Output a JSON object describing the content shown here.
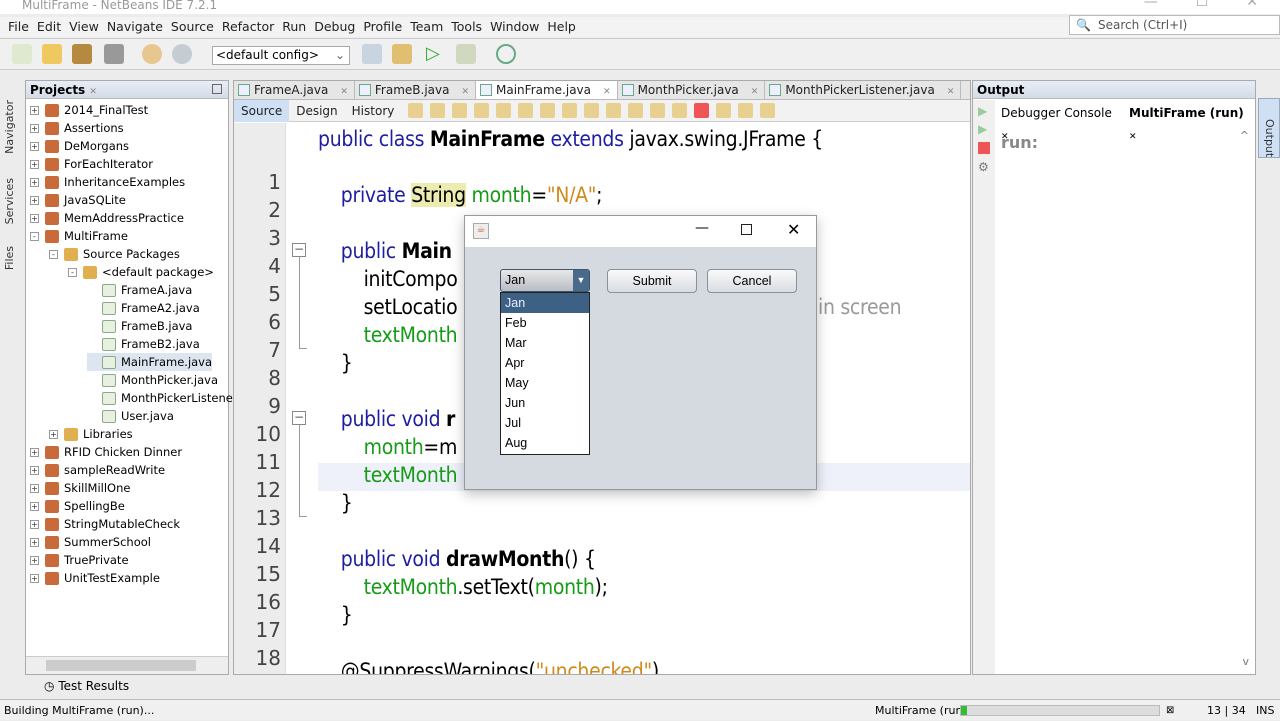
{
  "window": {
    "title": "MultiFrame - NetBeans IDE 7.2.1"
  },
  "menu": [
    "File",
    "Edit",
    "View",
    "Navigate",
    "Source",
    "Refactor",
    "Run",
    "Debug",
    "Profile",
    "Team",
    "Tools",
    "Window",
    "Help"
  ],
  "search": {
    "placeholder": "Search (Ctrl+I)"
  },
  "toolbar": {
    "config": "<default config>"
  },
  "side_tabs": [
    "Navigator",
    "Services",
    "Files"
  ],
  "projects": {
    "title": "Projects",
    "items": [
      {
        "label": "2014_FinalTest",
        "level": 0,
        "exp": "+"
      },
      {
        "label": "Assertions",
        "level": 0,
        "exp": "+"
      },
      {
        "label": "DeMorgans",
        "level": 0,
        "exp": "+"
      },
      {
        "label": "ForEachIterator",
        "level": 0,
        "exp": "+"
      },
      {
        "label": "InheritanceExamples",
        "level": 0,
        "exp": "+"
      },
      {
        "label": "JavaSQLite",
        "level": 0,
        "exp": "+"
      },
      {
        "label": "MemAddressPractice",
        "level": 0,
        "exp": "+"
      },
      {
        "label": "MultiFrame",
        "level": 0,
        "exp": "-"
      },
      {
        "label": "Source Packages",
        "level": 1,
        "exp": "-"
      },
      {
        "label": "<default package>",
        "level": 2,
        "exp": "-"
      },
      {
        "label": "FrameA.java",
        "level": 3
      },
      {
        "label": "FrameA2.java",
        "level": 3
      },
      {
        "label": "FrameB.java",
        "level": 3
      },
      {
        "label": "FrameB2.java",
        "level": 3
      },
      {
        "label": "MainFrame.java",
        "level": 3,
        "selected": true
      },
      {
        "label": "MonthPicker.java",
        "level": 3
      },
      {
        "label": "MonthPickerListener.java",
        "level": 3
      },
      {
        "label": "User.java",
        "level": 3
      },
      {
        "label": "Libraries",
        "level": 1,
        "exp": "+"
      },
      {
        "label": "RFID Chicken Dinner",
        "level": 0,
        "exp": "+"
      },
      {
        "label": "sampleReadWrite",
        "level": 0,
        "exp": "+"
      },
      {
        "label": "SkillMillOne",
        "level": 0,
        "exp": "+"
      },
      {
        "label": "SpellingBe",
        "level": 0,
        "exp": "+"
      },
      {
        "label": "StringMutableCheck",
        "level": 0,
        "exp": "+"
      },
      {
        "label": "SummerSchool",
        "level": 0,
        "exp": "+"
      },
      {
        "label": "TruePrivate",
        "level": 0,
        "exp": "+"
      },
      {
        "label": "UnitTestExample",
        "level": 0,
        "exp": "+"
      }
    ]
  },
  "editor": {
    "tabs": [
      "FrameA.java",
      "FrameB.java",
      "MainFrame.java",
      "MonthPicker.java",
      "MonthPickerListener.java"
    ],
    "active_tab": 2,
    "view_tabs": [
      "Source",
      "Design",
      "History"
    ],
    "lines": [
      [
        [
          "kw",
          "public class "
        ],
        [
          "b",
          "MainFrame"
        ],
        [
          "kw",
          " extends "
        ],
        [
          "",
          "javax.swing.JFrame {"
        ]
      ],
      [],
      [
        [
          "kw",
          "    private "
        ],
        [
          "hl",
          "String"
        ],
        [
          "fld",
          " month"
        ],
        [
          "",
          "="
        ],
        [
          "str",
          "\"N/A\""
        ],
        [
          "",
          ";"
        ]
      ],
      [],
      [
        [
          "kw",
          "    public "
        ],
        [
          "b",
          "Main"
        ]
      ],
      [
        [
          "",
          "        initCompo"
        ]
      ],
      [
        [
          "",
          "        setLocatio"
        ]
      ],
      [
        [
          "fld",
          "        textMonth"
        ]
      ],
      [
        [
          "",
          "    }"
        ]
      ],
      [],
      [
        [
          "kw",
          "    public void "
        ],
        [
          "b",
          "r"
        ]
      ],
      [
        [
          "fld",
          "        month"
        ],
        [
          "",
          "=m"
        ]
      ],
      [
        [
          "fld",
          "        textMonth"
        ]
      ],
      [
        [
          "",
          "    }"
        ]
      ],
      [],
      [
        [
          "kw",
          "    public void "
        ],
        [
          "b",
          "drawMonth"
        ],
        [
          "",
          "() {"
        ]
      ],
      [
        [
          "fld",
          "        textMonth"
        ],
        [
          "",
          ".setText("
        ],
        [
          "fld",
          "month"
        ],
        [
          "",
          ");"
        ]
      ],
      [
        [
          "",
          "    }"
        ]
      ],
      [],
      [
        [
          "",
          "    @SuppressWarnings("
        ],
        [
          "str",
          "\"unchecked\""
        ],
        [
          "",
          ")"
        ]
      ]
    ],
    "comment_fragment": "in screen",
    "first_line": 1
  },
  "output": {
    "title": "Output",
    "tabs": [
      "Debugger Console",
      "MultiFrame (run)"
    ],
    "text": "run:",
    "side_tab": "Output"
  },
  "bottom": {
    "test_results": "Test Results"
  },
  "status": {
    "left": "Building MultiFrame (run)...",
    "task": "MultiFrame (run)",
    "progress": 0.03,
    "position": "13 | 34",
    "mode": "INS"
  },
  "dialog": {
    "combo_value": "Jan",
    "options": [
      "Jan",
      "Feb",
      "Mar",
      "Apr",
      "May",
      "Jun",
      "Jul",
      "Aug"
    ],
    "selected_option": 0,
    "submit": "Submit",
    "cancel": "Cancel"
  }
}
